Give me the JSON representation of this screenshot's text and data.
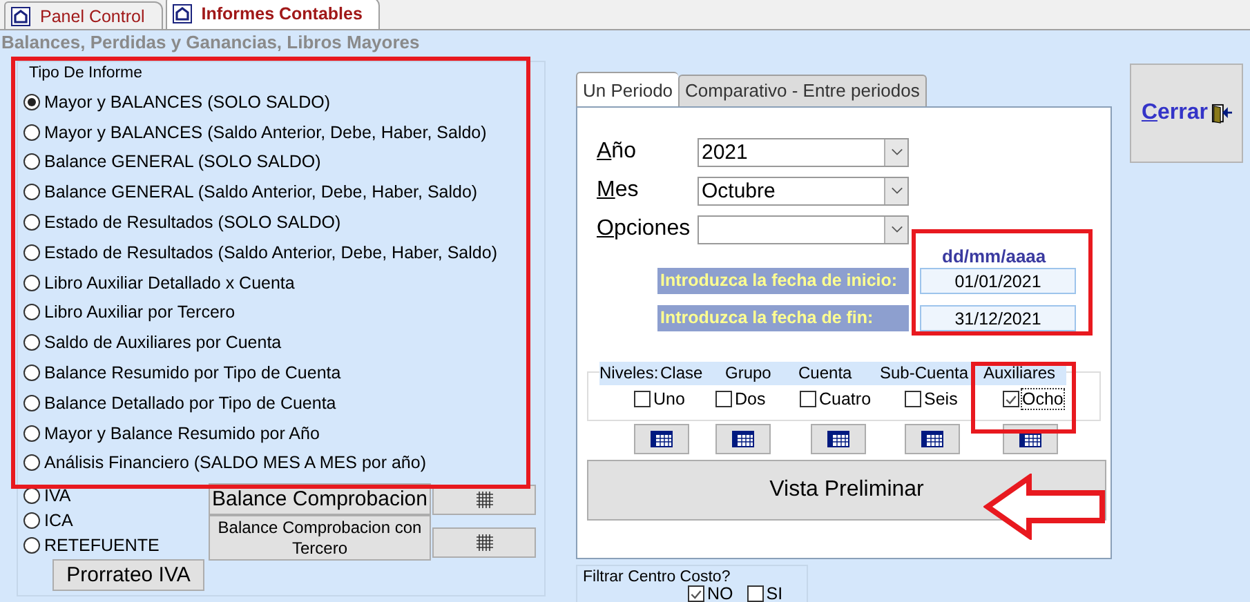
{
  "tabs": [
    {
      "label": "Panel Control",
      "selected": false
    },
    {
      "label": "Informes Contables",
      "selected": true
    }
  ],
  "subtitle": "Balances, Perdidas y Ganancias, Libros Mayores",
  "report_type": {
    "legend": "Tipo De Informe",
    "options": [
      {
        "label": "Mayor y BALANCES (SOLO SALDO)",
        "selected": true
      },
      {
        "label": "Mayor y BALANCES (Saldo Anterior, Debe, Haber, Saldo)",
        "selected": false
      },
      {
        "label": "Balance GENERAL (SOLO SALDO)",
        "selected": false
      },
      {
        "label": "Balance GENERAL (Saldo Anterior, Debe, Haber, Saldo)",
        "selected": false
      },
      {
        "label": "Estado de Resultados (SOLO SALDO)",
        "selected": false
      },
      {
        "label": "Estado de Resultados (Saldo Anterior, Debe, Haber, Saldo)",
        "selected": false
      },
      {
        "label": "Libro Auxiliar Detallado x Cuenta",
        "selected": false
      },
      {
        "label": "Libro Auxiliar por Tercero",
        "selected": false
      },
      {
        "label": "Saldo de Auxiliares por Cuenta",
        "selected": false
      },
      {
        "label": "Balance Resumido por Tipo de Cuenta",
        "selected": false
      },
      {
        "label": "Balance Detallado por Tipo de Cuenta",
        "selected": false
      },
      {
        "label": "Mayor y Balance Resumido por Año",
        "selected": false
      },
      {
        "label": "Análisis Financiero (SALDO MES A MES por año)",
        "selected": false
      }
    ]
  },
  "tax_options": [
    {
      "label": "IVA",
      "selected": false
    },
    {
      "label": "ICA",
      "selected": false
    },
    {
      "label": "RETEFUENTE",
      "selected": false
    }
  ],
  "prorate_button": "Prorrateo IVA",
  "balance_buttons": [
    "Balance Comprobacion",
    "Balance Comprobacion con Tercero"
  ],
  "period_tabs": [
    {
      "label": "Un Periodo",
      "selected": true
    },
    {
      "label": "Comparativo - Entre periodos",
      "selected": false
    }
  ],
  "fields": [
    {
      "label": "Año",
      "value": "2021"
    },
    {
      "label": "Mes",
      "value": "Octubre"
    },
    {
      "label": "Opciones"
    }
  ],
  "date_format": "dd/mm/aaaa",
  "dates": [
    {
      "label": "Introduzca la fecha de inicio:",
      "value": "01/01/2021"
    },
    {
      "label": "Introduzca la fecha de fin:",
      "value": "31/12/2021"
    }
  ],
  "levels": {
    "label": "Niveles:",
    "columns": [
      {
        "heading": "Clase",
        "option": "Uno",
        "checked": false
      },
      {
        "heading": "Grupo",
        "option": "Dos",
        "checked": false
      },
      {
        "heading": "Cuenta",
        "option": "Cuatro",
        "checked": false
      },
      {
        "heading": "Sub-Cuenta",
        "option": "Seis",
        "checked": false
      },
      {
        "heading": "Auxiliares",
        "option": "Ocho",
        "checked": true
      }
    ]
  },
  "preview_button": "Vista Preliminar",
  "cost_filter": {
    "legend": "Filtrar Centro Costo?",
    "options": [
      {
        "label": "NO",
        "checked": true
      },
      {
        "label": "SI",
        "checked": false
      }
    ]
  },
  "close_button": "Cerrar"
}
